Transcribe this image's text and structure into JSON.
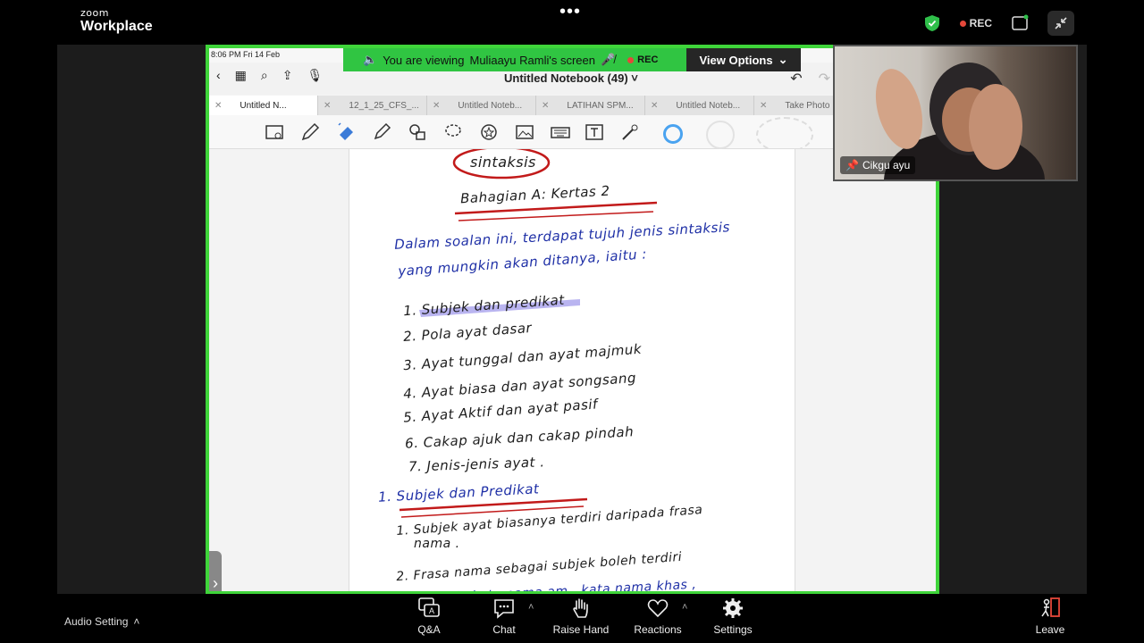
{
  "app": {
    "brand_small": "zoom",
    "brand_big": "Workplace",
    "rec_label": "REC"
  },
  "share": {
    "status_time": "8:06 PM  Fri 14 Feb",
    "banner_prefix": "You are viewing",
    "banner_name": "Muliaayu Ramli's screen",
    "banner_rec": "REC",
    "view_options": "View Options",
    "notebook_title": "Untitled Notebook (49)",
    "tabs": [
      {
        "label": "Untitled N...",
        "active": true
      },
      {
        "label": "12_1_25_CFS_..."
      },
      {
        "label": "Untitled Noteb..."
      },
      {
        "label": "LATIHAN SPM..."
      },
      {
        "label": "Untitled Noteb..."
      },
      {
        "label": "Take Photo"
      }
    ]
  },
  "notes": {
    "title": "sintaksis",
    "subtitle": "Bahagian A: Kertas 2",
    "intro_1": "Dalam soalan ini, terdapat tujuh jenis sintaksis",
    "intro_2": "yang mungkin akan ditanya, iaitu :",
    "items": [
      "1.  Subjek dan predikat",
      "2.  Pola ayat dasar",
      "3.  Ayat tunggal dan ayat majmuk",
      "4.  Ayat biasa dan ayat songsang",
      "5.  Ayat Aktif dan ayat pasif",
      "6.  Cakap ajuk dan cakap pindah",
      "7.  Jenis-jenis ayat ."
    ],
    "section": "1. Subjek dan Predikat",
    "point_1a": "1. Subjek ayat biasanya terdiri daripada frasa",
    "point_1b": "nama .",
    "point_2a": "2. Frasa nama sebagai subjek boleh terdiri",
    "point_2b": "daripada kata nama am , kata nama khas ,"
  },
  "participant": {
    "name": "Cikgu ayu"
  },
  "bottom": {
    "audio_setting": "Audio Setting",
    "qa": "Q&A",
    "chat": "Chat",
    "raise_hand": "Raise Hand",
    "reactions": "Reactions",
    "settings": "Settings",
    "leave": "Leave"
  },
  "colors": {
    "share_border": "#3fd53a",
    "ink_blue": "#1e2fa6",
    "ink_red": "#c21a1a",
    "highlight": "#b9b4f0"
  }
}
